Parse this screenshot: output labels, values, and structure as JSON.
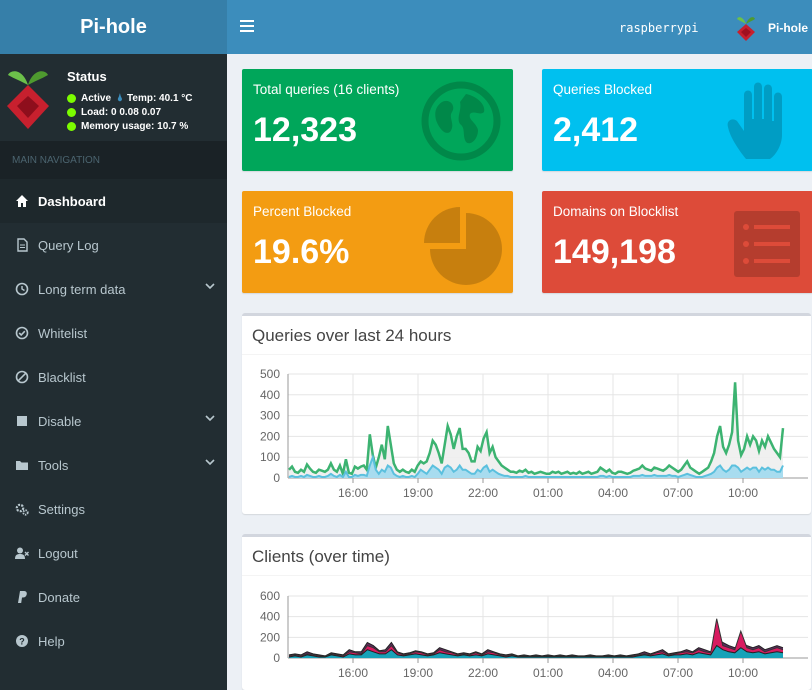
{
  "app": {
    "name": "Pi-hole"
  },
  "topbar": {
    "hostname": "raspberrypi",
    "user_label": "Pi-hole"
  },
  "status": {
    "title": "Status",
    "active": "Active",
    "temp": "Temp: 40.1 °C",
    "load": "Load:  0  0.08  0.07",
    "memory": "Memory usage:  10.7 %"
  },
  "nav": {
    "header": "MAIN NAVIGATION",
    "items": [
      {
        "label": "Dashboard",
        "icon": "home-icon"
      },
      {
        "label": "Query Log",
        "icon": "file-icon"
      },
      {
        "label": "Long term data",
        "icon": "clock-icon"
      },
      {
        "label": "Whitelist",
        "icon": "check-circle-icon"
      },
      {
        "label": "Blacklist",
        "icon": "ban-icon"
      },
      {
        "label": "Disable",
        "icon": "stop-icon"
      },
      {
        "label": "Tools",
        "icon": "folder-icon"
      },
      {
        "label": "Settings",
        "icon": "gears-icon"
      },
      {
        "label": "Logout",
        "icon": "user-times-icon"
      },
      {
        "label": "Donate",
        "icon": "paypal-icon"
      },
      {
        "label": "Help",
        "icon": "question-circle-icon"
      }
    ]
  },
  "stats": {
    "total_queries": {
      "label": "Total queries (16 clients)",
      "value": "12,323",
      "color": "#00a65a",
      "icon": "globe-icon"
    },
    "queries_blocked": {
      "label": "Queries Blocked",
      "value": "2,412",
      "color": "#00c0ef",
      "icon": "hand-icon"
    },
    "percent_blocked": {
      "label": "Percent Blocked",
      "value": "19.6%",
      "color": "#f39c12",
      "icon": "pie-chart-icon"
    },
    "domains_blocklist": {
      "label": "Domains on Blocklist",
      "value": "149,198",
      "color": "#dd4b39",
      "icon": "list-icon"
    }
  },
  "colors": {
    "total_line": "#3cb371",
    "blocked_line": "#5bc0de",
    "total_fill": "#eeeeee",
    "blocked_fill": "#a8dcef"
  },
  "chart_data": [
    {
      "type": "area",
      "title": "Queries over last 24 hours",
      "x_ticks": [
        "16:00",
        "19:00",
        "22:00",
        "01:00",
        "04:00",
        "07:00",
        "10:00"
      ],
      "y_ticks": [
        "0",
        "100",
        "200",
        "300",
        "400",
        "500"
      ],
      "ylim": [
        0,
        500
      ],
      "x_range_hours": [
        13,
        37
      ],
      "series": [
        {
          "name": "",
          "values": [
            40,
            55,
            30,
            25,
            40,
            30,
            65,
            45,
            30,
            25,
            40,
            35,
            30,
            40,
            70,
            40,
            30,
            60,
            20,
            90,
            25,
            20,
            55,
            45,
            55,
            60,
            40,
            210,
            110,
            50,
            100,
            160,
            90,
            250,
            160,
            70,
            40,
            30,
            40,
            30,
            25,
            40,
            30,
            60,
            80,
            70,
            80,
            120,
            180,
            160,
            120,
            70,
            160,
            250,
            210,
            140,
            200,
            240,
            140,
            140,
            120,
            80,
            80,
            150,
            130,
            190,
            220,
            120,
            150,
            100,
            80,
            60,
            50,
            40,
            30,
            30,
            25,
            35,
            30,
            40,
            25,
            30,
            20,
            25,
            30,
            25,
            20,
            20,
            30,
            25,
            30,
            20,
            25,
            30,
            20,
            25,
            20,
            30,
            20,
            25,
            30,
            20,
            25,
            30,
            50,
            40,
            30,
            40,
            25,
            20,
            30,
            30,
            25,
            20,
            25,
            35,
            40,
            45,
            60,
            45,
            40,
            35,
            50,
            45,
            40,
            35,
            45,
            60,
            50,
            40,
            30,
            40,
            60,
            80,
            50,
            40,
            30,
            20,
            30,
            40,
            50,
            80,
            120,
            200,
            250,
            150,
            120,
            160,
            220,
            460,
            180,
            110,
            140,
            200,
            160,
            200,
            180,
            130,
            180,
            150,
            200,
            170,
            140,
            120,
            100,
            240
          ]
        },
        {
          "name": "",
          "values": [
            5,
            10,
            5,
            5,
            10,
            5,
            15,
            10,
            5,
            5,
            10,
            5,
            5,
            10,
            20,
            10,
            5,
            15,
            5,
            30,
            5,
            5,
            15,
            10,
            15,
            15,
            10,
            60,
            100,
            40,
            20,
            40,
            30,
            60,
            50,
            20,
            10,
            5,
            10,
            5,
            5,
            10,
            5,
            20,
            40,
            30,
            20,
            40,
            60,
            50,
            40,
            20,
            50,
            60,
            50,
            30,
            40,
            60,
            40,
            40,
            30,
            20,
            20,
            40,
            30,
            50,
            60,
            30,
            40,
            30,
            20,
            15,
            10,
            10,
            5,
            5,
            5,
            5,
            5,
            10,
            5,
            5,
            5,
            5,
            5,
            5,
            5,
            5,
            5,
            5,
            5,
            5,
            5,
            5,
            5,
            5,
            5,
            5,
            5,
            5,
            5,
            5,
            5,
            5,
            10,
            10,
            5,
            10,
            5,
            5,
            5,
            5,
            5,
            5,
            5,
            10,
            10,
            10,
            15,
            10,
            10,
            10,
            15,
            10,
            10,
            10,
            10,
            15,
            10,
            10,
            5,
            10,
            15,
            20,
            15,
            10,
            5,
            5,
            5,
            10,
            15,
            20,
            30,
            50,
            60,
            40,
            30,
            40,
            60,
            60,
            50,
            30,
            40,
            50,
            40,
            50,
            50,
            30,
            50,
            40,
            50,
            40,
            40,
            30,
            30,
            60
          ]
        }
      ]
    },
    {
      "type": "area",
      "title": "Clients (over time)",
      "x_ticks": [
        "16:00",
        "19:00",
        "22:00",
        "01:00",
        "04:00",
        "07:00",
        "10:00"
      ],
      "y_ticks": [
        "0",
        "200",
        "400",
        "600"
      ],
      "ylim": [
        0,
        600
      ],
      "x_range_hours": [
        13,
        37
      ],
      "series": [
        {
          "name": "",
          "values": [
            30,
            40,
            30,
            60,
            40,
            30,
            20,
            50,
            40,
            30,
            80,
            60,
            60,
            150,
            120,
            70,
            80,
            150,
            60,
            40,
            50,
            70,
            60,
            40,
            50,
            100,
            80,
            60,
            40,
            50,
            40,
            60,
            40,
            80,
            60,
            40,
            30,
            40,
            20,
            30,
            20,
            30,
            20,
            30,
            20,
            30,
            20,
            30,
            20,
            20,
            30,
            20,
            20,
            30,
            20,
            30,
            20,
            30,
            40,
            60,
            40,
            60,
            80,
            40,
            50,
            60,
            80,
            60,
            100,
            80,
            60,
            200,
            150,
            120,
            100,
            150,
            120,
            100,
            120,
            80,
            100,
            120,
            100
          ]
        },
        {
          "name": "",
          "values": [
            20,
            30,
            20,
            40,
            30,
            20,
            15,
            40,
            30,
            20,
            60,
            50,
            40,
            120,
            100,
            60,
            60,
            120,
            50,
            30,
            40,
            60,
            50,
            30,
            40,
            80,
            60,
            50,
            30,
            40,
            30,
            50,
            30,
            60,
            50,
            30,
            20,
            30,
            15,
            20,
            15,
            20,
            15,
            20,
            15,
            20,
            15,
            20,
            15,
            15,
            20,
            15,
            15,
            20,
            15,
            20,
            15,
            20,
            30,
            40,
            30,
            50,
            60,
            30,
            40,
            50,
            60,
            50,
            80,
            60,
            50,
            380,
            120,
            100,
            80,
            260,
            100,
            80,
            100,
            60,
            80,
            100,
            80
          ]
        },
        {
          "name": "",
          "values": [
            10,
            20,
            10,
            30,
            20,
            10,
            10,
            30,
            20,
            10,
            40,
            30,
            30,
            80,
            60,
            40,
            40,
            80,
            30,
            20,
            30,
            40,
            30,
            20,
            30,
            50,
            40,
            30,
            20,
            30,
            20,
            30,
            20,
            40,
            30,
            20,
            10,
            20,
            10,
            10,
            10,
            10,
            10,
            10,
            10,
            10,
            10,
            10,
            10,
            10,
            10,
            10,
            10,
            10,
            10,
            10,
            10,
            10,
            20,
            30,
            20,
            30,
            40,
            20,
            30,
            30,
            40,
            30,
            50,
            40,
            30,
            120,
            80,
            60,
            50,
            100,
            60,
            50,
            60,
            40,
            50,
            60,
            50
          ]
        }
      ]
    }
  ]
}
